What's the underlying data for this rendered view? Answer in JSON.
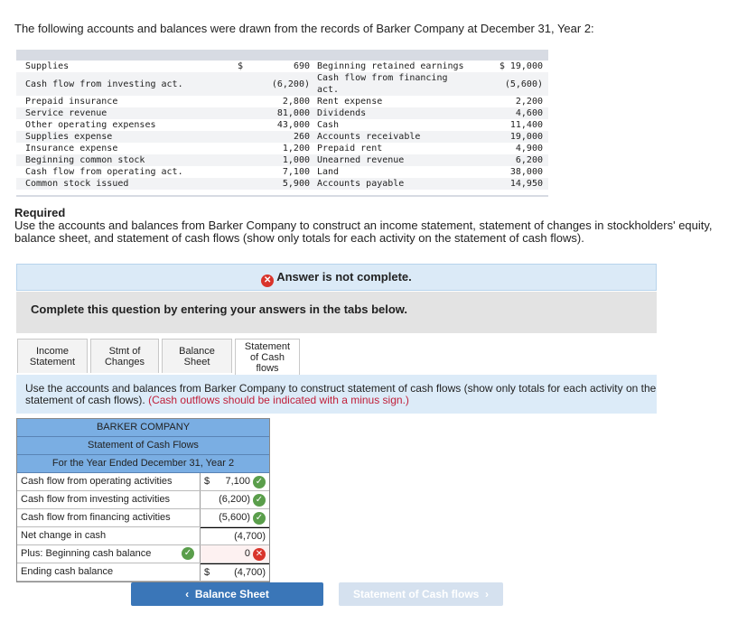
{
  "intro": "The following accounts and balances were drawn from the records of Barker Company at December 31, Year 2:",
  "accounts": [
    {
      "l": "Supplies",
      "lv": "690",
      "r": "Beginning retained earnings",
      "rv": "19,000",
      "ld": "$",
      "rd": "$"
    },
    {
      "l": "Cash flow from investing act.",
      "lv": "(6,200)",
      "r": "Cash flow from financing act.",
      "rv": "(5,600)"
    },
    {
      "l": "Prepaid insurance",
      "lv": "2,800",
      "r": "Rent expense",
      "rv": "2,200"
    },
    {
      "l": "Service revenue",
      "lv": "81,000",
      "r": "Dividends",
      "rv": "4,600"
    },
    {
      "l": "Other operating expenses",
      "lv": "43,000",
      "r": "Cash",
      "rv": "11,400"
    },
    {
      "l": "Supplies expense",
      "lv": "260",
      "r": "Accounts receivable",
      "rv": "19,000"
    },
    {
      "l": "Insurance expense",
      "lv": "1,200",
      "r": "Prepaid rent",
      "rv": "4,900"
    },
    {
      "l": "Beginning common stock",
      "lv": "1,000",
      "r": "Unearned revenue",
      "rv": "6,200"
    },
    {
      "l": "Cash flow from operating act.",
      "lv": "7,100",
      "r": "Land",
      "rv": "38,000"
    },
    {
      "l": "Common stock issued",
      "lv": "5,900",
      "r": "Accounts payable",
      "rv": "14,950"
    }
  ],
  "required": {
    "title": "Required",
    "text": "Use the accounts and balances from Barker Company to construct an income statement, statement of changes in stockholders' equity, balance sheet, and statement of cash flows (show only totals for each activity on the statement of cash flows)."
  },
  "answer_status": "Answer is not complete.",
  "complete_prompt": "Complete this question by entering your answers in the tabs below.",
  "tabs": [
    {
      "label": "Income Statement"
    },
    {
      "label": "Stmt of Changes"
    },
    {
      "label": "Balance Sheet"
    },
    {
      "label": "Statement of Cash flows",
      "active": true
    }
  ],
  "instructions": {
    "text": "Use the accounts and balances from Barker Company to construct statement of cash flows (show only totals for each activity on the statement of cash flows).",
    "note": "(Cash outflows should be indicated with a minus sign.)"
  },
  "statement": {
    "company": "BARKER COMPANY",
    "title": "Statement of Cash Flows",
    "period": "For the Year Ended December 31, Year 2",
    "rows": [
      {
        "label": "Cash flow from operating activities",
        "dollar": "$",
        "value": "7,100",
        "status": "correct"
      },
      {
        "label": "Cash flow from investing activities",
        "value": "(6,200)",
        "status": "correct"
      },
      {
        "label": "Cash flow from financing activities",
        "value": "(5,600)",
        "status": "correct"
      },
      {
        "label": "Net change in cash",
        "value": "(4,700)"
      },
      {
        "label": "Plus: Beginning cash balance",
        "value": "0",
        "status": "incorrect",
        "label_status": "correct"
      },
      {
        "label": "Ending cash balance",
        "dollar": "$",
        "value": "(4,700)"
      }
    ]
  },
  "nav": {
    "prev": "Balance Sheet",
    "next": "Statement of Cash flows"
  },
  "colors": {
    "header": "#7aaee3",
    "correct": "#5a9e4b",
    "incorrect": "#d9342b",
    "prev_btn": "#3a76b8",
    "next_btn": "#d5e1ef"
  }
}
